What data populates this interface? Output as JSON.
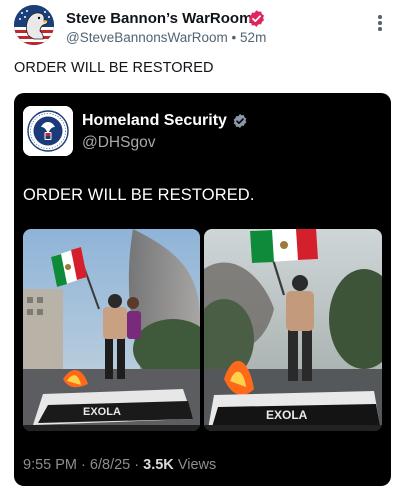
{
  "post": {
    "author_name": "Steve Bannon’s WarRoom",
    "author_handle": "@SteveBannonsWarRoom",
    "separator": "•",
    "time_ago": "52m",
    "text": "ORDER WILL BE RESTORED"
  },
  "quoted": {
    "author_name": "Homeland Security",
    "author_handle": "@DHSgov",
    "text": "ORDER WILL BE RESTORED.",
    "logo_text": "U.S. DEPARTMENT OF HOMELAND SECURITY",
    "time": "9:55 PM",
    "dot": "·",
    "date": "6/8/25",
    "views_count": "3.5K",
    "views_label": "Views",
    "vehicle_lettering": "EXOLA",
    "media": [
      {
        "description": "protester-holding-mexican-flag-on-car-wide"
      },
      {
        "description": "protester-holding-mexican-flag-on-car-closeup"
      }
    ]
  },
  "colors": {
    "badge_pink": "#e0245e",
    "verified_gray": "#8b98a5",
    "flag_green": "#0e8a3a",
    "flag_red": "#d3202c",
    "fire": "#ff6a1a"
  },
  "icons": {
    "more": "more-vertical-icon",
    "verified": "verified-badge-icon"
  }
}
